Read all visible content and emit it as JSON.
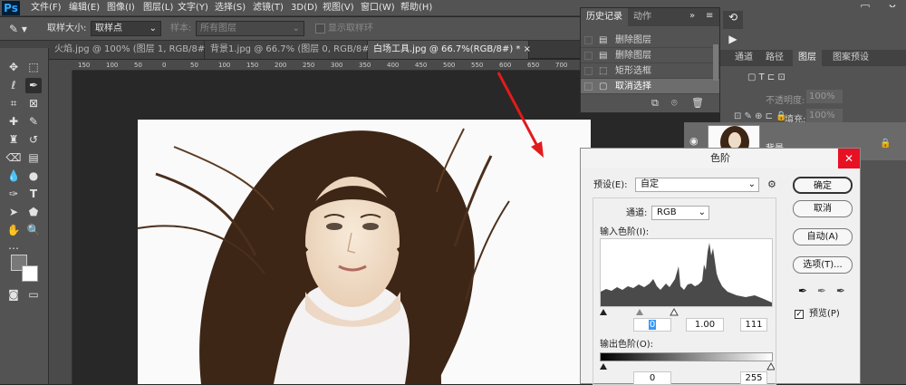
{
  "app": {
    "logo": "Ps"
  },
  "menu": [
    "文件(F)",
    "编辑(E)",
    "图像(I)",
    "图层(L)",
    "文字(Y)",
    "选择(S)",
    "滤镜(T)",
    "3D(D)",
    "视图(V)",
    "窗口(W)",
    "帮助(H)"
  ],
  "window_controls": {
    "minimize": "—",
    "maximize": "□",
    "close": "✕"
  },
  "options": {
    "sample_size_label": "取样大小:",
    "sample_size_value": "取样点",
    "sample_label": "样本:",
    "sample_value": "所有图层",
    "show_ring_label": "显示取样环"
  },
  "tabs": [
    {
      "label": "火焰.jpg @ 100% (图层 1, RGB/8#) *",
      "close": "×"
    },
    {
      "label": "背景1.jpg @ 66.7% (图层 0, RGB/8#) *",
      "close": "×"
    },
    {
      "label": "白场工具.jpg @ 66.7%(RGB/8#) *",
      "close": "×"
    }
  ],
  "ruler_ticks": [
    "150",
    "100",
    "50",
    "0",
    "50",
    "100",
    "150",
    "200",
    "250",
    "300",
    "350",
    "400",
    "450",
    "500",
    "550",
    "600",
    "650",
    "700",
    "750",
    "800"
  ],
  "history_panel": {
    "tabs": [
      "历史记录",
      "动作"
    ],
    "items": [
      "删除图层",
      "删除图层",
      "矩形选框",
      "取消选择"
    ]
  },
  "layers_panel": {
    "tabs": [
      "通道",
      "路径",
      "图层",
      "图案预设"
    ],
    "opacity_label": "不透明度:",
    "opacity_value": "100%",
    "fill_label": "填充:",
    "fill_value": "100%",
    "lock_label": "锁定:",
    "layer_name": "背景"
  },
  "levels_dialog": {
    "title": "色阶",
    "preset_label": "预设(E):",
    "preset_value": "自定",
    "channel_label": "通道:",
    "channel_value": "RGB",
    "input_label": "输入色阶(I):",
    "input_black": "0",
    "input_gamma": "1.00",
    "input_white": "111",
    "output_label": "输出色阶(O):",
    "output_black": "0",
    "output_white": "255",
    "buttons": {
      "ok": "确定",
      "cancel": "取消",
      "auto": "自动(A)",
      "options": "选项(T)..."
    },
    "preview_label": "预览(P)",
    "preview_checked": true
  },
  "colors": {
    "accent": "#31a8ff",
    "arrow": "#e21b1b",
    "close": "#e81123"
  }
}
